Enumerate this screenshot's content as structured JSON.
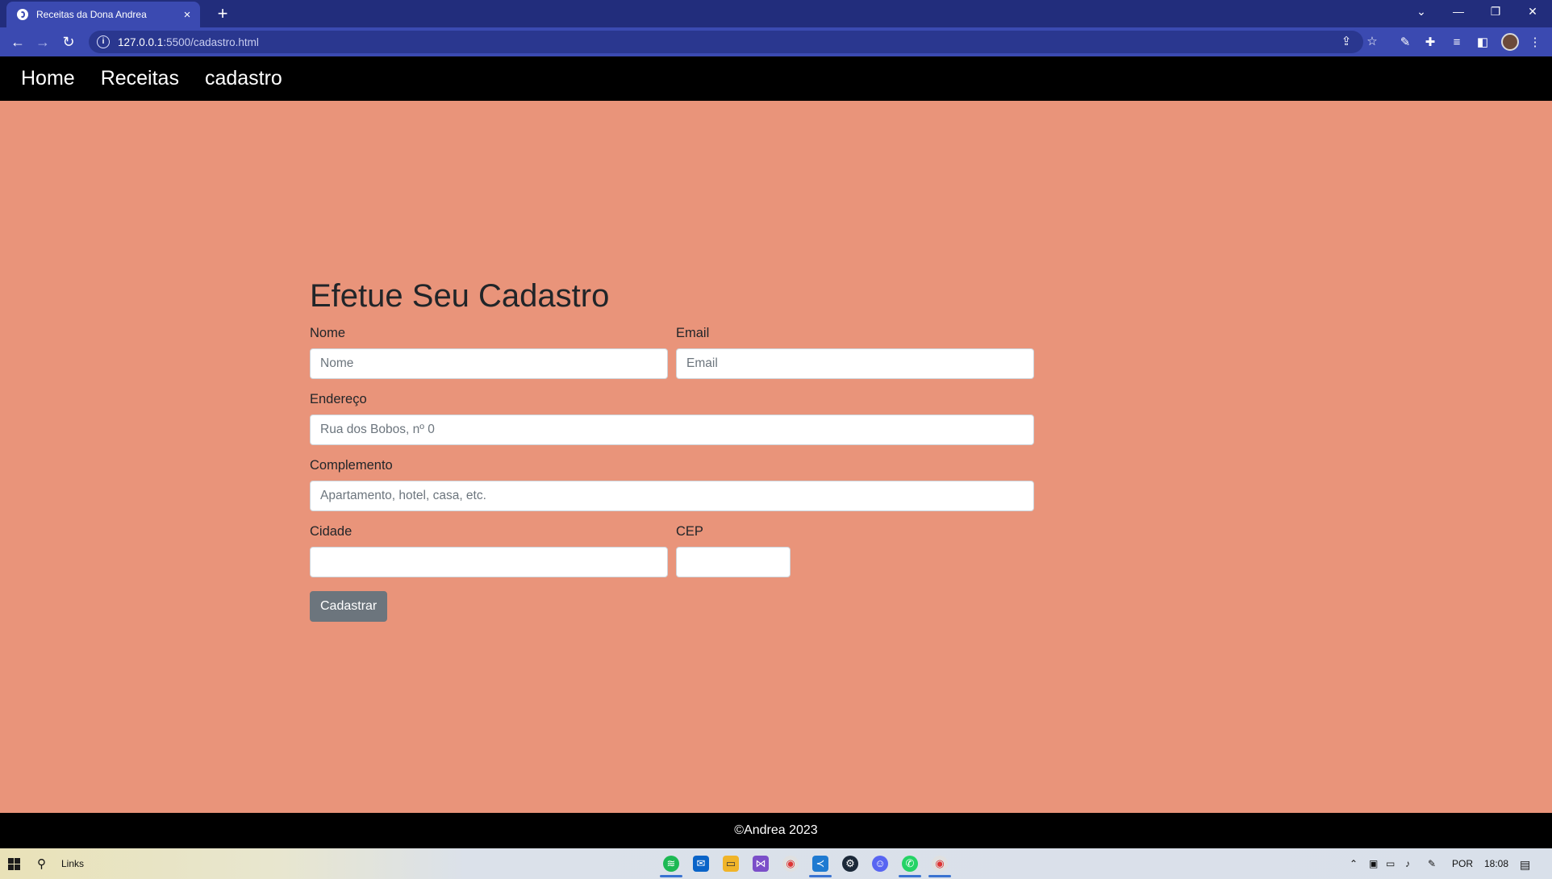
{
  "browser": {
    "tab_title": "Receitas da Dona Andrea",
    "tab_close": "×",
    "new_tab": "+",
    "url_host": "127.0.0.1",
    "url_path": ":5500/cadastro.html",
    "window_controls": [
      "⌄",
      "—",
      "❐",
      "✕"
    ],
    "nav_icons": [
      "back-icon",
      "forward-icon",
      "reload-icon"
    ]
  },
  "nav": {
    "items": [
      "Home",
      "Receitas",
      "cadastro"
    ]
  },
  "form": {
    "title": "Efetue Seu Cadastro",
    "nome": {
      "label": "Nome",
      "placeholder": "Nome"
    },
    "email": {
      "label": "Email",
      "placeholder": "Email"
    },
    "endereco": {
      "label": "Endereço",
      "placeholder": "Rua dos Bobos, nº 0"
    },
    "complemento": {
      "label": "Complemento",
      "placeholder": "Apartamento, hotel, casa, etc."
    },
    "cidade": {
      "label": "Cidade",
      "placeholder": ""
    },
    "cep": {
      "label": "CEP",
      "placeholder": ""
    },
    "submit": "Cadastrar"
  },
  "footer": {
    "text": "©Andrea 2023"
  },
  "taskbar": {
    "search_label": "Links",
    "language": "POR",
    "time": "18:08"
  },
  "colors": {
    "page_bg": "#e9947a",
    "nav_bg": "#000000",
    "button_bg": "#6c757d",
    "browser_tabbar": "#222d7c",
    "browser_toolbar": "#3b4ab1"
  }
}
